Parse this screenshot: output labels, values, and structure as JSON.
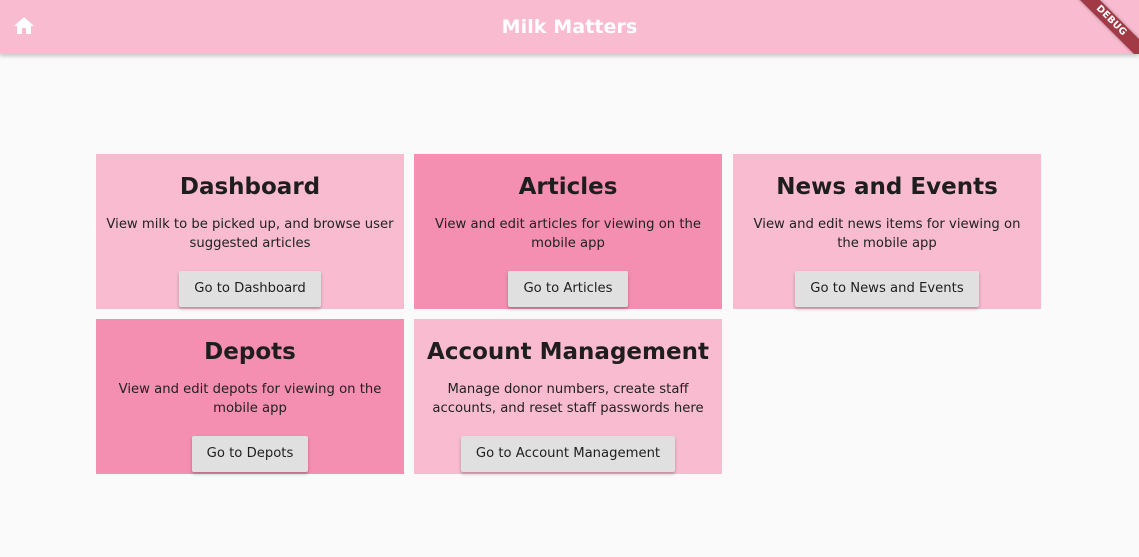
{
  "appbar": {
    "title": "Milk Matters",
    "home_icon": "home-icon",
    "debug_label": "DEBUG"
  },
  "colors": {
    "appbar": "#f8bbd0",
    "card_light": "#f8bbd0",
    "card_dark": "#f48fb1",
    "button": "#e0e0e0",
    "background": "#fafafa"
  },
  "cards": [
    {
      "title": "Dashboard",
      "description": "View milk to be picked up, and browse user suggested articles",
      "button": "Go to Dashboard",
      "shade": "light"
    },
    {
      "title": "Articles",
      "description": "View and edit articles for viewing on the mobile app",
      "button": "Go to Articles",
      "shade": "dark"
    },
    {
      "title": "News and Events",
      "description": "View and edit news items for viewing on the mobile app",
      "button": "Go to News and Events",
      "shade": "light"
    },
    {
      "title": "Depots",
      "description": "View and edit depots for viewing on the mobile app",
      "button": "Go to Depots",
      "shade": "dark"
    },
    {
      "title": "Account Management",
      "description": "Manage donor numbers, create staff accounts, and reset staff passwords here",
      "button": "Go to Account Management",
      "shade": "light"
    }
  ]
}
